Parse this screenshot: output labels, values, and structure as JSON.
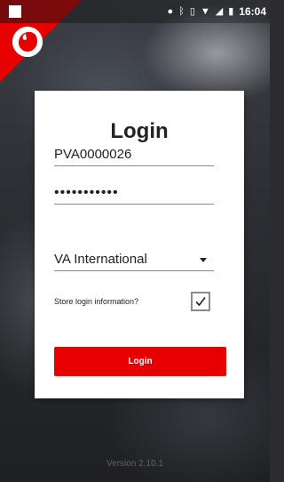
{
  "status_bar": {
    "time": "16:04",
    "icons": [
      "location-icon",
      "bluetooth-icon",
      "vibrate-icon",
      "wifi-icon",
      "signal-icon",
      "battery-icon"
    ]
  },
  "brand": {
    "logo_icon": "vodafone-logo-icon",
    "accent_color": "#e60000"
  },
  "login_card": {
    "title": "Login",
    "username_value": "PVA0000026",
    "password_value": "•••••••••••",
    "company_select_value": "VA International",
    "store_login_label": "Store login information?",
    "store_login_checked": true,
    "login_button_label": "Login"
  },
  "footer": {
    "version": "Version 2.10.1"
  }
}
